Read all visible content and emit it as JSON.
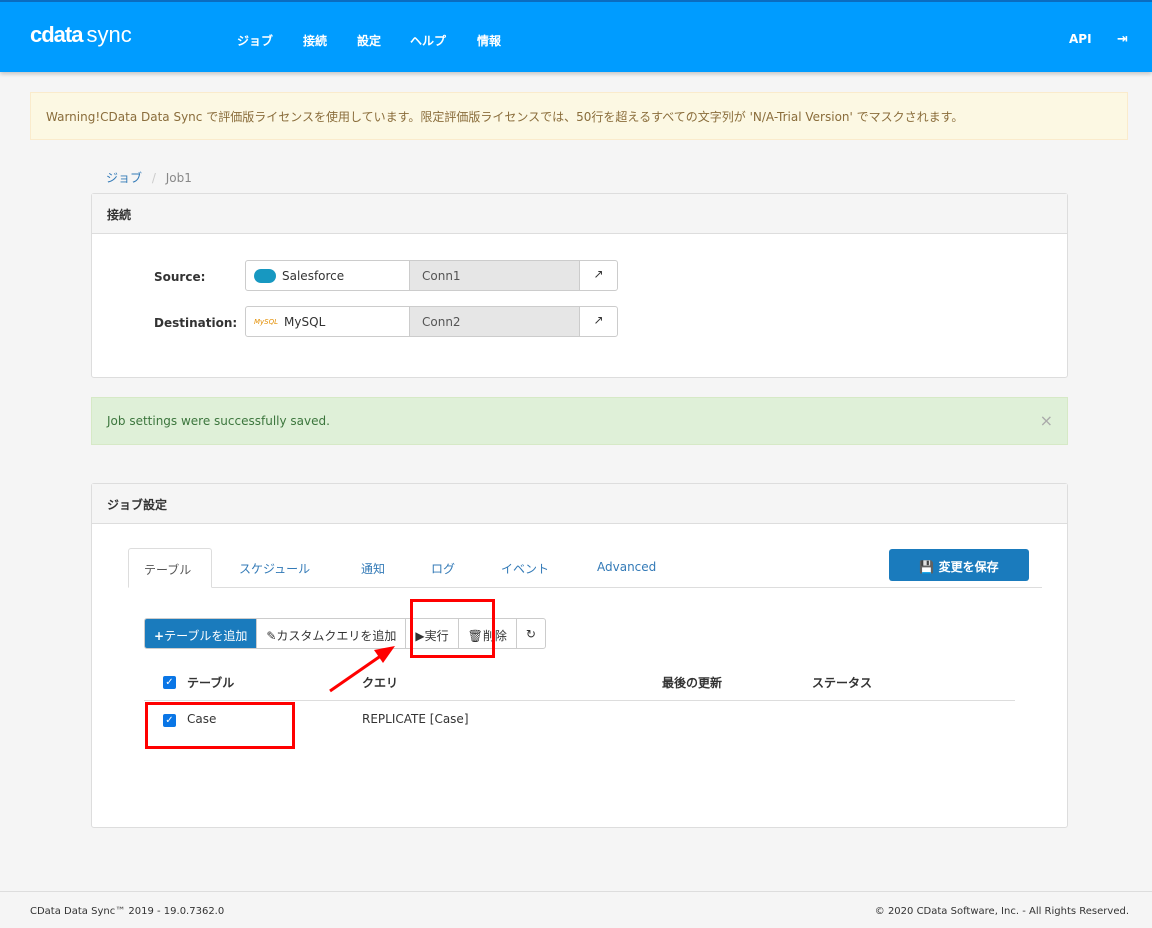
{
  "header": {
    "logo": "cdata sync",
    "nav": [
      "ジョブ",
      "接続",
      "設定",
      "ヘルプ",
      "情報"
    ],
    "api": "API"
  },
  "warning": "Warning!CData Data Sync で評価版ライセンスを使用しています。限定評価版ライセンスでは、50行を超えるすべての文字列が 'N/A-Trial Version' でマスクされます。",
  "breadcrumb": {
    "root": "ジョブ",
    "sep": "/",
    "current": "Job1"
  },
  "connections": {
    "title": "接続",
    "source_label": "Source:",
    "source_type": "Salesforce",
    "source_conn": "Conn1",
    "dest_label": "Destination:",
    "dest_type": "MySQL",
    "dest_conn": "Conn2"
  },
  "alert": {
    "text": "Job settings were successfully saved.",
    "close": "×"
  },
  "job_settings": {
    "title": "ジョブ設定",
    "tabs": [
      "テーブル",
      "スケジュール",
      "通知",
      "ログ",
      "イベント",
      "Advanced"
    ],
    "save": "変更を保存",
    "toolbar": {
      "add_table": "テーブルを追加",
      "add_query": "カスタムクエリを追加",
      "run": "実行",
      "delete": "削除"
    },
    "columns": [
      "テーブル",
      "クエリ",
      "最後の更新",
      "ステータス"
    ],
    "rows": [
      {
        "table": "Case",
        "query": "REPLICATE [Case]"
      }
    ]
  },
  "footer": {
    "left": "CData Data Sync™ 2019 - 19.0.7362.0",
    "right": "© 2020 CData Software, Inc. - All Rights Reserved."
  }
}
